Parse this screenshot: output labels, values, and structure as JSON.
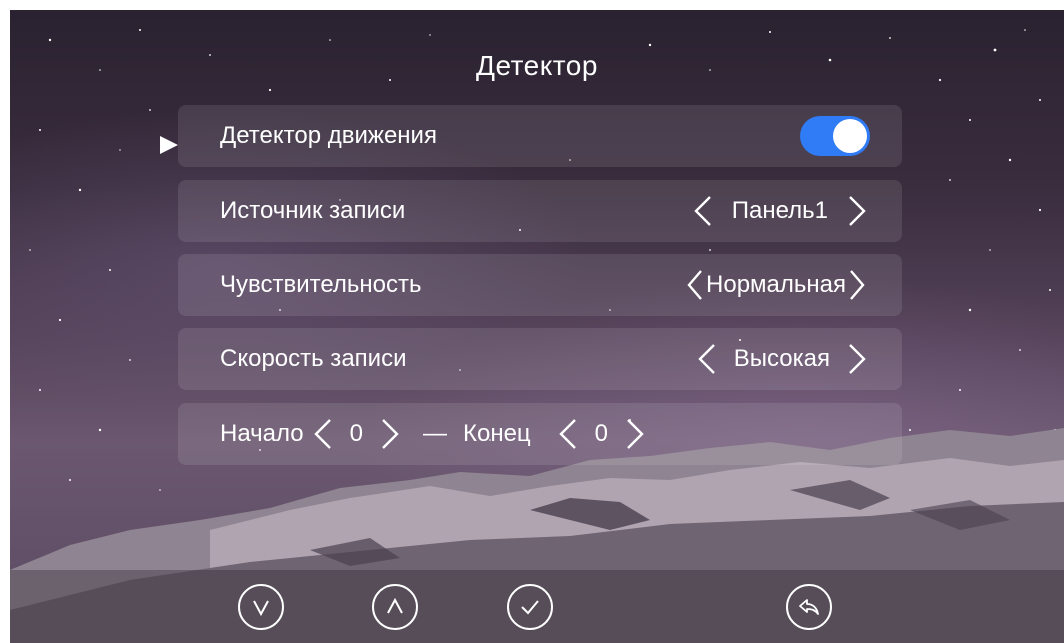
{
  "screen": {
    "title": "Детектор"
  },
  "menu": {
    "items": [
      {
        "label": "Детектор движения",
        "control": "toggle",
        "toggle_on": true,
        "selected": true
      },
      {
        "label": "Источник записи",
        "value": "Панель1"
      },
      {
        "label": "Чувствительность",
        "value": "Нормальная"
      },
      {
        "label": "Скорость записи",
        "value": "Высокая"
      }
    ],
    "schedule": {
      "start_label": "Начало",
      "start_value": "0",
      "separator": "—",
      "end_label": "Конец",
      "end_value": "0"
    }
  },
  "bottom_bar": {
    "buttons": [
      {
        "icon": "chevron-down-circle-icon"
      },
      {
        "icon": "chevron-up-circle-icon"
      },
      {
        "icon": "check-circle-icon"
      },
      {
        "icon": "back-arrow-circle-icon"
      }
    ]
  },
  "colors": {
    "toggle_on": "#2f7cf6",
    "text": "#ffffff",
    "row_bg": "rgba(255,255,255,0.10)"
  }
}
